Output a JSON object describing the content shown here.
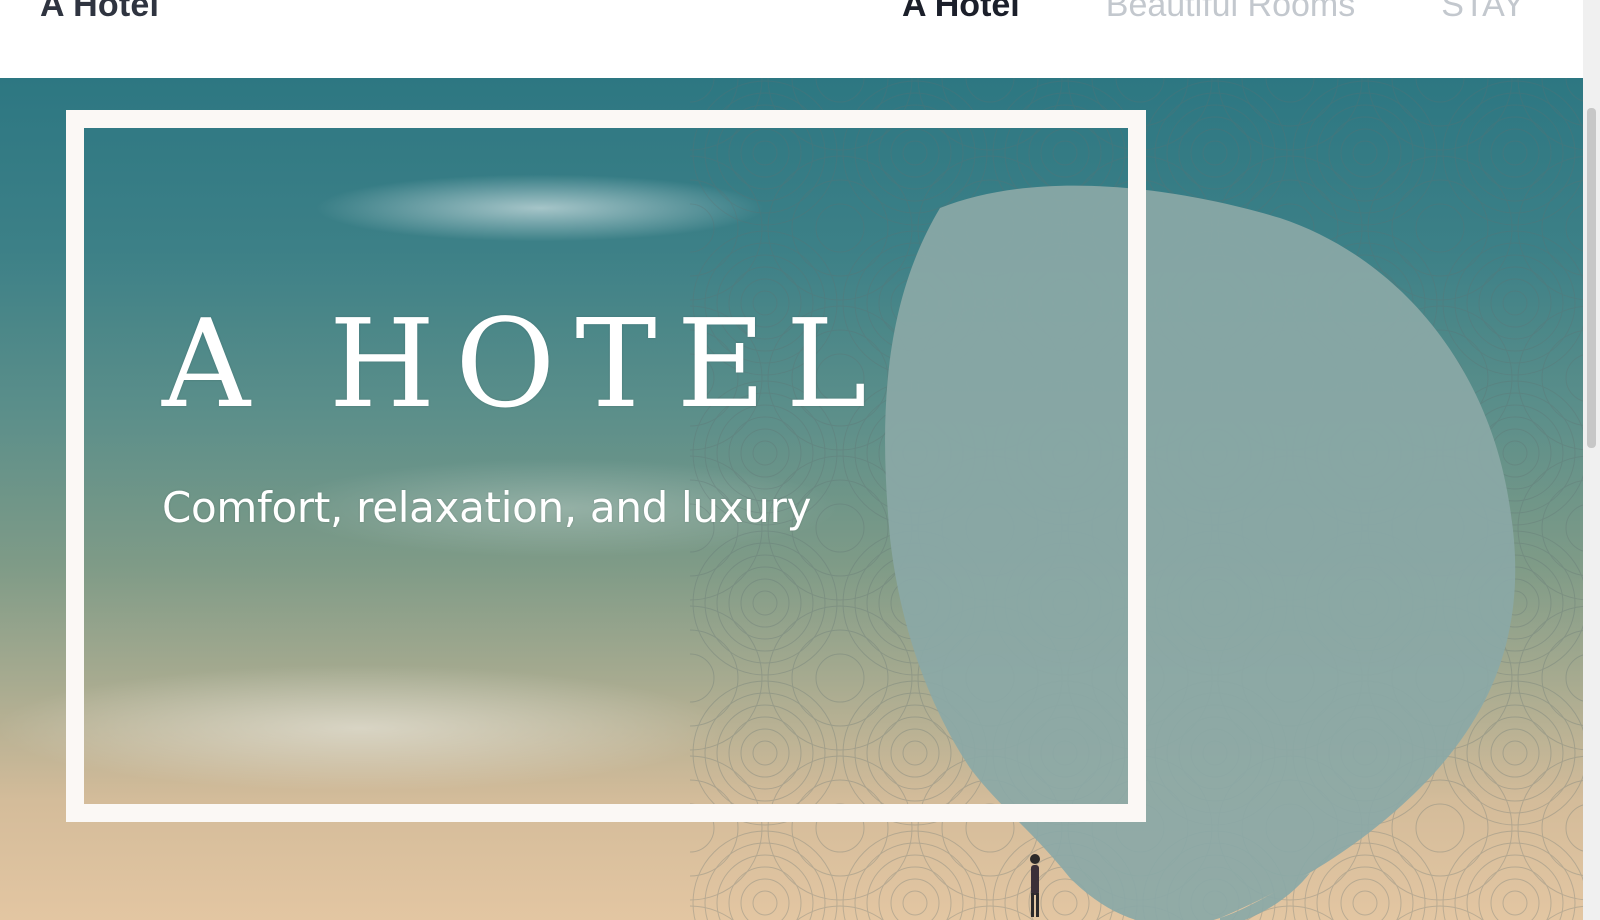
{
  "header": {
    "brand": "A Hotel",
    "nav": [
      {
        "label": "A Hotel",
        "active": true
      },
      {
        "label": "Beautiful Rooms",
        "active": false
      },
      {
        "label": "STAY",
        "active": false
      }
    ]
  },
  "hero": {
    "title": "A HOTEL",
    "subtitle": "Comfort, relaxation, and luxury"
  },
  "colors": {
    "nav_active": "#1b1f2a",
    "nav_inactive": "#c3c8ce",
    "frame": "#fbf8f5",
    "brush_blob": "#8ba9a7"
  }
}
